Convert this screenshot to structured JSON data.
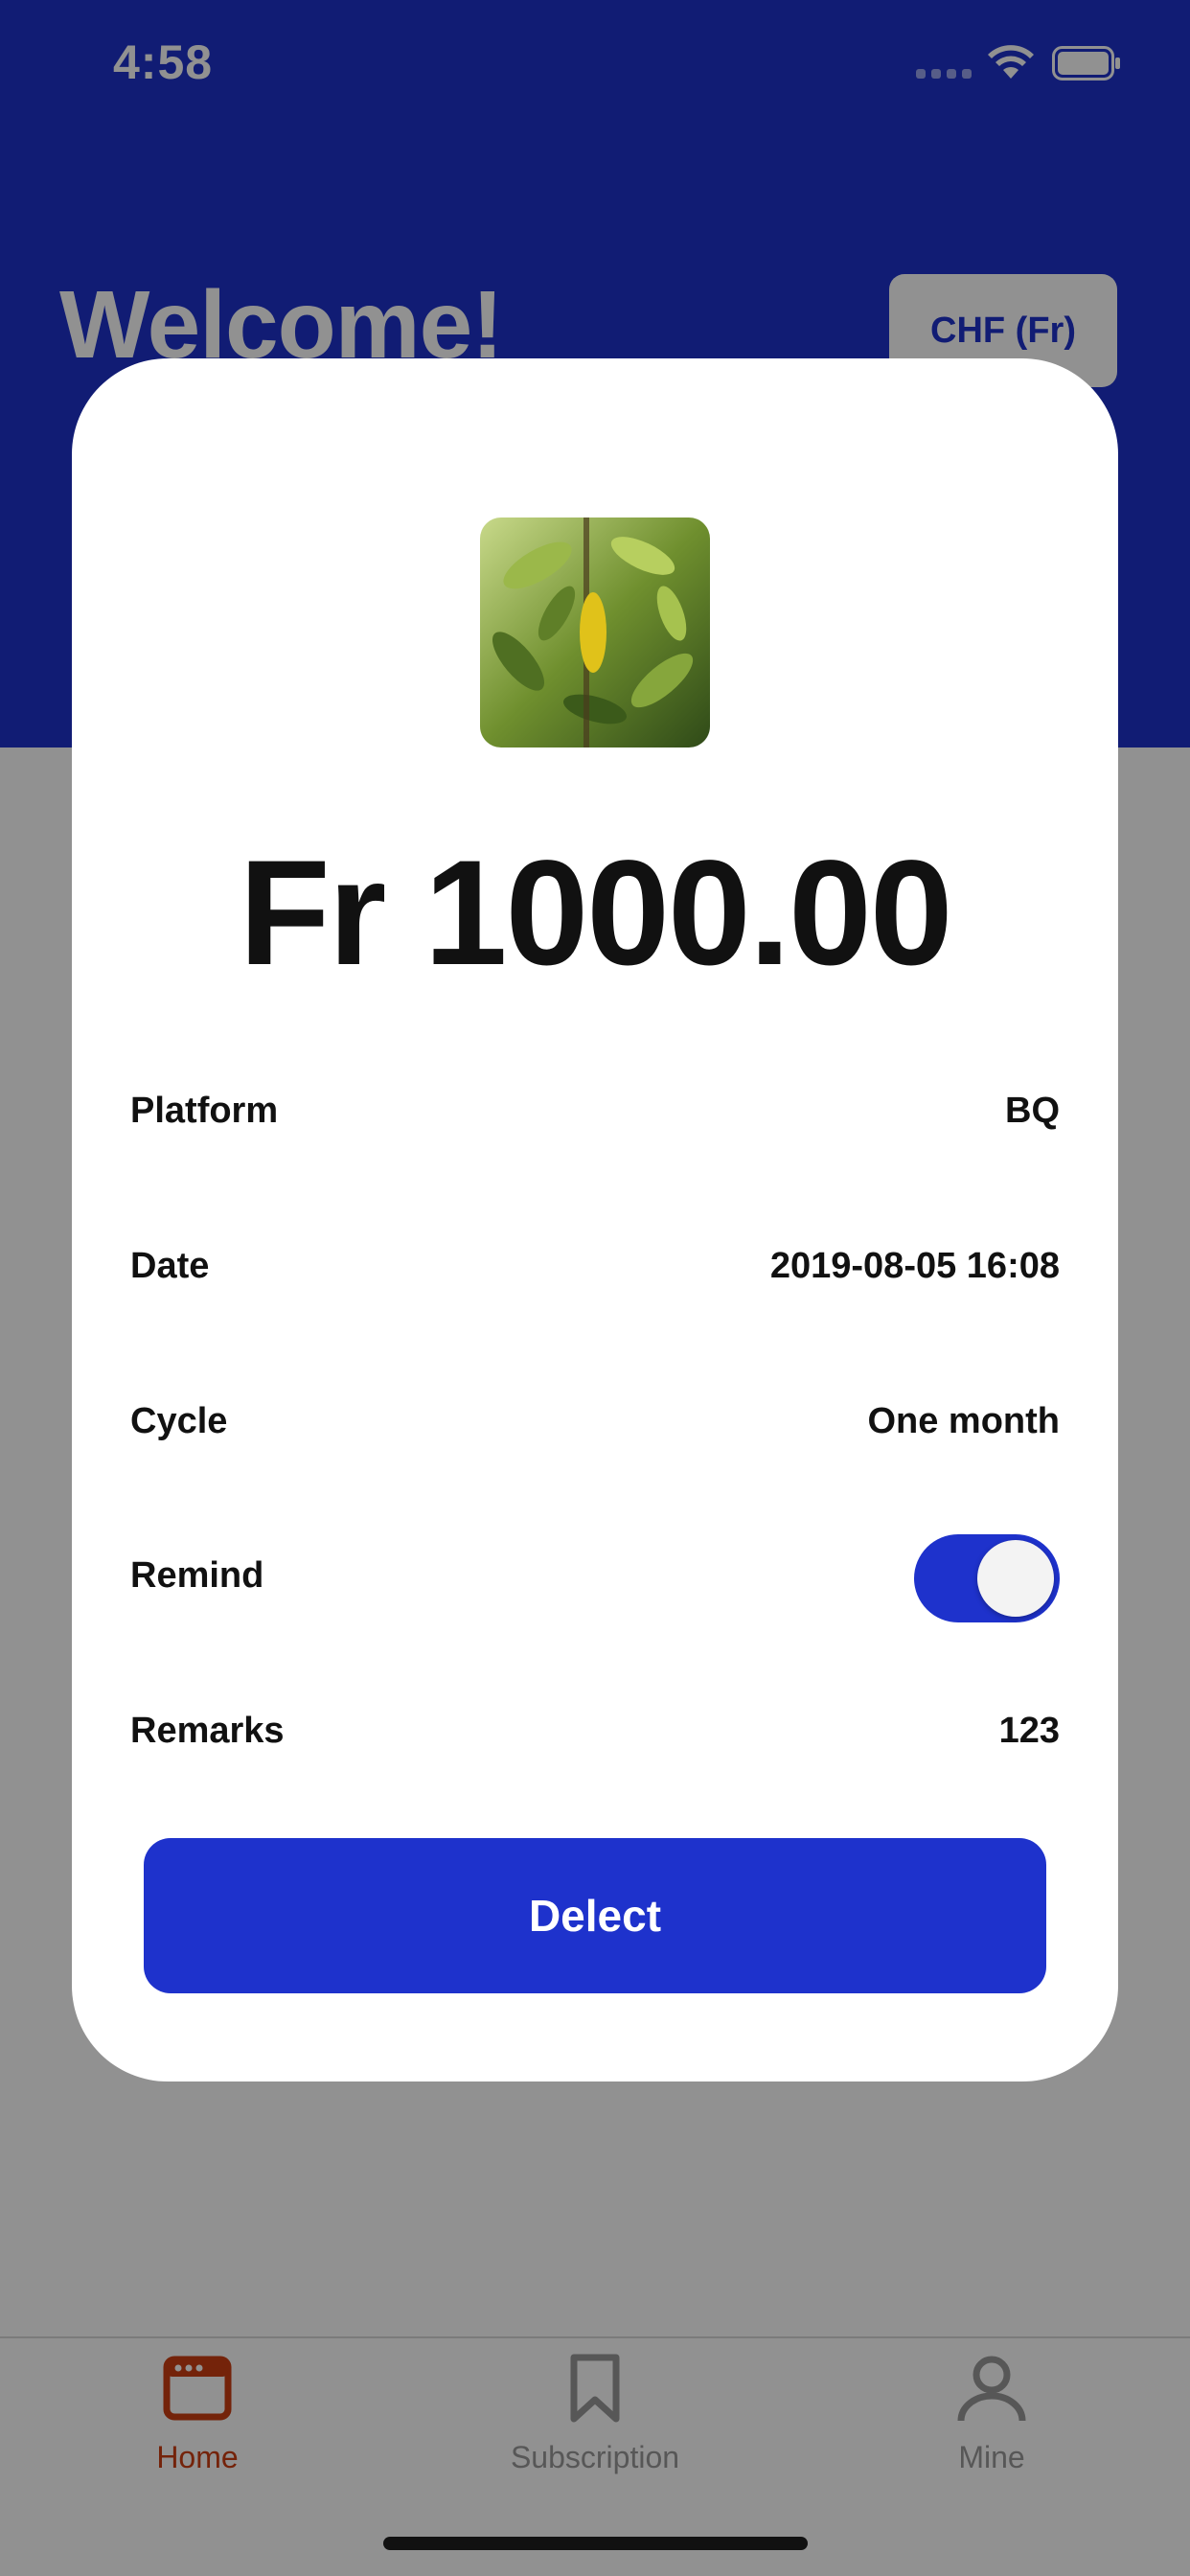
{
  "status_bar": {
    "time": "4:58"
  },
  "header": {
    "title": "Welcome!",
    "currency_button": "CHF (Fr)"
  },
  "colors": {
    "primary": "#1e32cc",
    "tab_active": "#cc3e12",
    "tab_inactive": "#9a9a9a"
  },
  "card": {
    "amount": "Fr 1000.00",
    "rows": [
      {
        "label": "Platform",
        "value": "BQ"
      },
      {
        "label": "Date",
        "value": "2019-08-05 16:08"
      },
      {
        "label": "Cycle",
        "value": "One month"
      },
      {
        "label": "Remind",
        "toggle_on": true
      },
      {
        "label": "Remarks",
        "value": "123"
      }
    ],
    "action_button": "Delect"
  },
  "tabbar": {
    "tabs": [
      {
        "label": "Home",
        "icon": "browser-window-icon",
        "active": true
      },
      {
        "label": "Subscription",
        "icon": "bookmark-icon",
        "active": false
      },
      {
        "label": "Mine",
        "icon": "person-icon",
        "active": false
      }
    ]
  }
}
